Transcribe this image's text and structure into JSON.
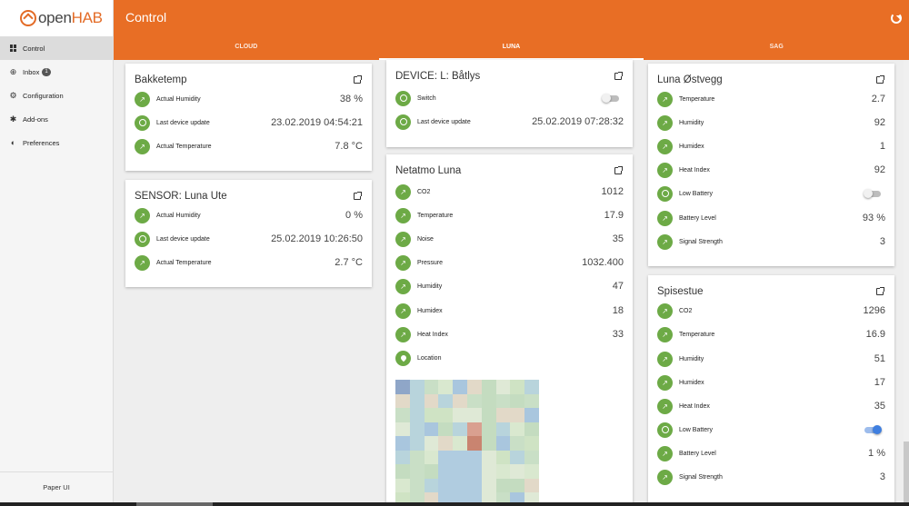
{
  "logo": {
    "name_a": "open",
    "name_b": "HAB"
  },
  "sidebar": {
    "items": [
      {
        "label": "Control",
        "icon": "grid-icon"
      },
      {
        "label": "Inbox",
        "icon": "add-circle-icon",
        "badge": "1"
      },
      {
        "label": "Configuration",
        "icon": "gear-icon"
      },
      {
        "label": "Add-ons",
        "icon": "puzzle-icon"
      },
      {
        "label": "Preferences",
        "icon": "contrast-icon"
      }
    ],
    "footer": "Paper UI"
  },
  "header": {
    "title": "Control",
    "refresh_icon": "refresh-icon"
  },
  "tabs": [
    {
      "label": "CLOUD"
    },
    {
      "label": "LUNA"
    },
    {
      "label": "SAG"
    }
  ],
  "colors": {
    "header": "#e86e25",
    "accent_green": "#6daa46",
    "toggle_on": "#3f7fe0"
  },
  "cards": {
    "bakketemp": {
      "title": "Bakketemp",
      "rows": [
        {
          "label": "Actual Humidity",
          "value": "38 %"
        },
        {
          "label": "Last device update",
          "value": "23.02.2019 04:54:21"
        },
        {
          "label": "Actual Temperature",
          "value": "7.8 °C"
        }
      ]
    },
    "sensor_luna_ute": {
      "title": "SENSOR: Luna Ute",
      "rows": [
        {
          "label": "Actual Humidity",
          "value": "0 %"
        },
        {
          "label": "Last device update",
          "value": "25.02.2019 10:26:50"
        },
        {
          "label": "Actual Temperature",
          "value": "2.7 °C"
        }
      ]
    },
    "device_batlys": {
      "title": "DEVICE: L: Båtlys",
      "rows": [
        {
          "label": "Switch",
          "value": "",
          "toggle": false
        },
        {
          "label": "Last device update",
          "value": "25.02.2019 07:28:32"
        }
      ]
    },
    "netatmo_luna": {
      "title": "Netatmo Luna",
      "rows": [
        {
          "label": "CO2",
          "value": "1012"
        },
        {
          "label": "Temperature",
          "value": "17.9"
        },
        {
          "label": "Noise",
          "value": "35"
        },
        {
          "label": "Pressure",
          "value": "1032.400"
        },
        {
          "label": "Humidity",
          "value": "47"
        },
        {
          "label": "Humidex",
          "value": "18"
        },
        {
          "label": "Heat Index",
          "value": "33"
        },
        {
          "label": "Location",
          "value": ""
        }
      ]
    },
    "luna_ostvegg": {
      "title": "Luna Østvegg",
      "rows": [
        {
          "label": "Temperature",
          "value": "2.7"
        },
        {
          "label": "Humidity",
          "value": "92"
        },
        {
          "label": "Humidex",
          "value": "1"
        },
        {
          "label": "Heat Index",
          "value": "92"
        },
        {
          "label": "Low Battery",
          "value": "",
          "toggle": false
        },
        {
          "label": "Battery Level",
          "value": "93 %"
        },
        {
          "label": "Signal Strength",
          "value": "3"
        }
      ]
    },
    "spisestue": {
      "title": "Spisestue",
      "rows": [
        {
          "label": "CO2",
          "value": "1296"
        },
        {
          "label": "Temperature",
          "value": "16.9"
        },
        {
          "label": "Humidity",
          "value": "51"
        },
        {
          "label": "Humidex",
          "value": "17"
        },
        {
          "label": "Heat Index",
          "value": "35"
        },
        {
          "label": "Low Battery",
          "value": "",
          "toggle": true
        },
        {
          "label": "Battery Level",
          "value": "1 %"
        },
        {
          "label": "Signal Strength",
          "value": "3"
        }
      ]
    }
  }
}
